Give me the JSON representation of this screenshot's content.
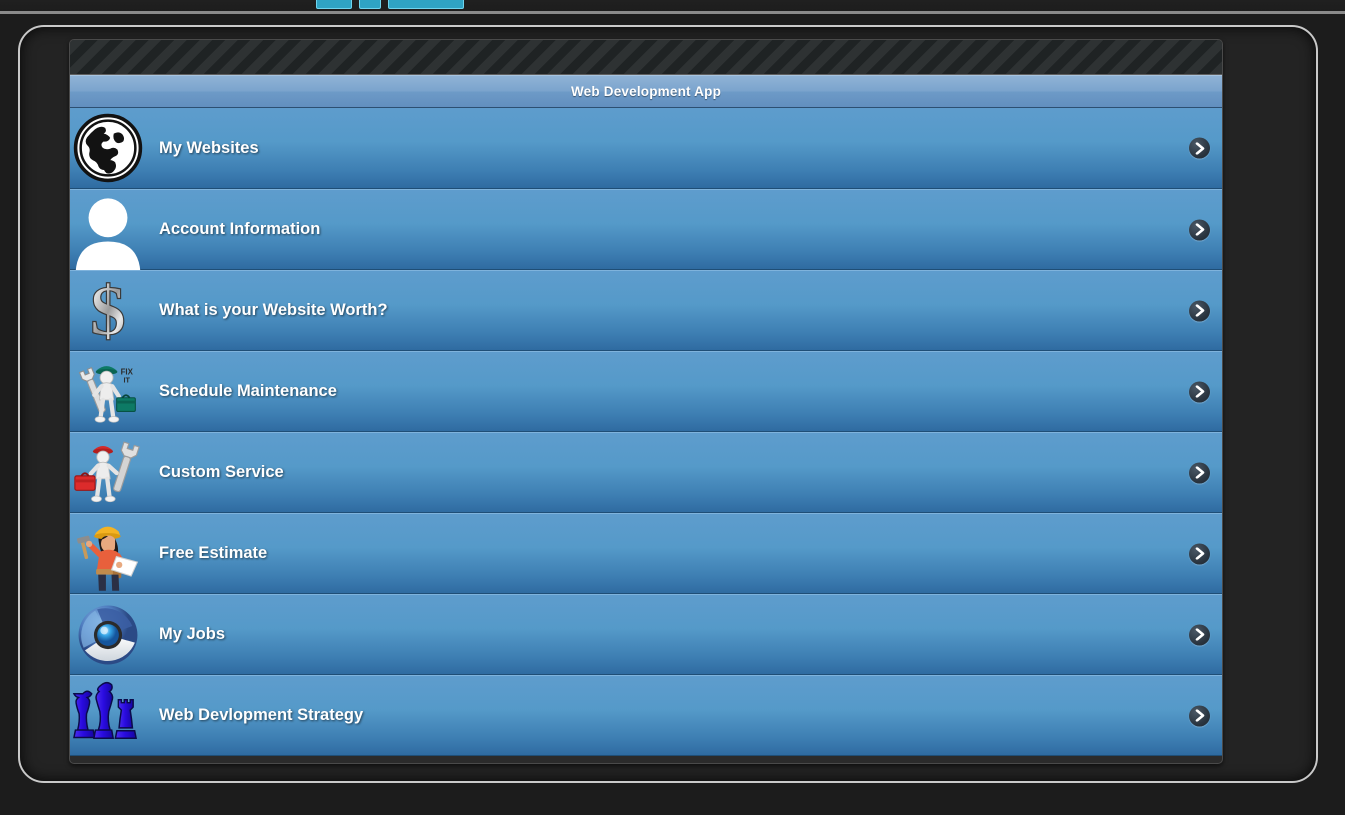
{
  "window": {
    "top_chips": [
      "chip-1",
      "chip-2",
      "chip-3"
    ]
  },
  "app": {
    "title": "Web Development App",
    "title_color": "#ffffff",
    "titlebar_color": "#7ba4cd",
    "row_color_top": "#5e9ccd",
    "row_color_bottom": "#2f6ba1",
    "frame_border_color": "#c9c9c9",
    "background_color": "#1c1c1c"
  },
  "menu": {
    "items": [
      {
        "label": "My Websites",
        "icon": "globe-icon",
        "chevron": "chevron-right-icon"
      },
      {
        "label": "Account Information",
        "icon": "person-icon",
        "chevron": "chevron-right-icon"
      },
      {
        "label": "What is your Website Worth?",
        "icon": "dollar-sign-icon",
        "chevron": "chevron-right-icon"
      },
      {
        "label": "Schedule Maintenance",
        "icon": "fix-it-worker-icon",
        "chevron": "chevron-right-icon"
      },
      {
        "label": "Custom Service",
        "icon": "wrench-worker-icon",
        "chevron": "chevron-right-icon"
      },
      {
        "label": "Free Estimate",
        "icon": "estimator-icon",
        "chevron": "chevron-right-icon"
      },
      {
        "label": "My Jobs",
        "icon": "chromium-browser-icon",
        "chevron": "chevron-right-icon"
      },
      {
        "label": "Web Devlopment Strategy",
        "icon": "chess-pieces-icon",
        "chevron": "chevron-right-icon"
      }
    ]
  }
}
